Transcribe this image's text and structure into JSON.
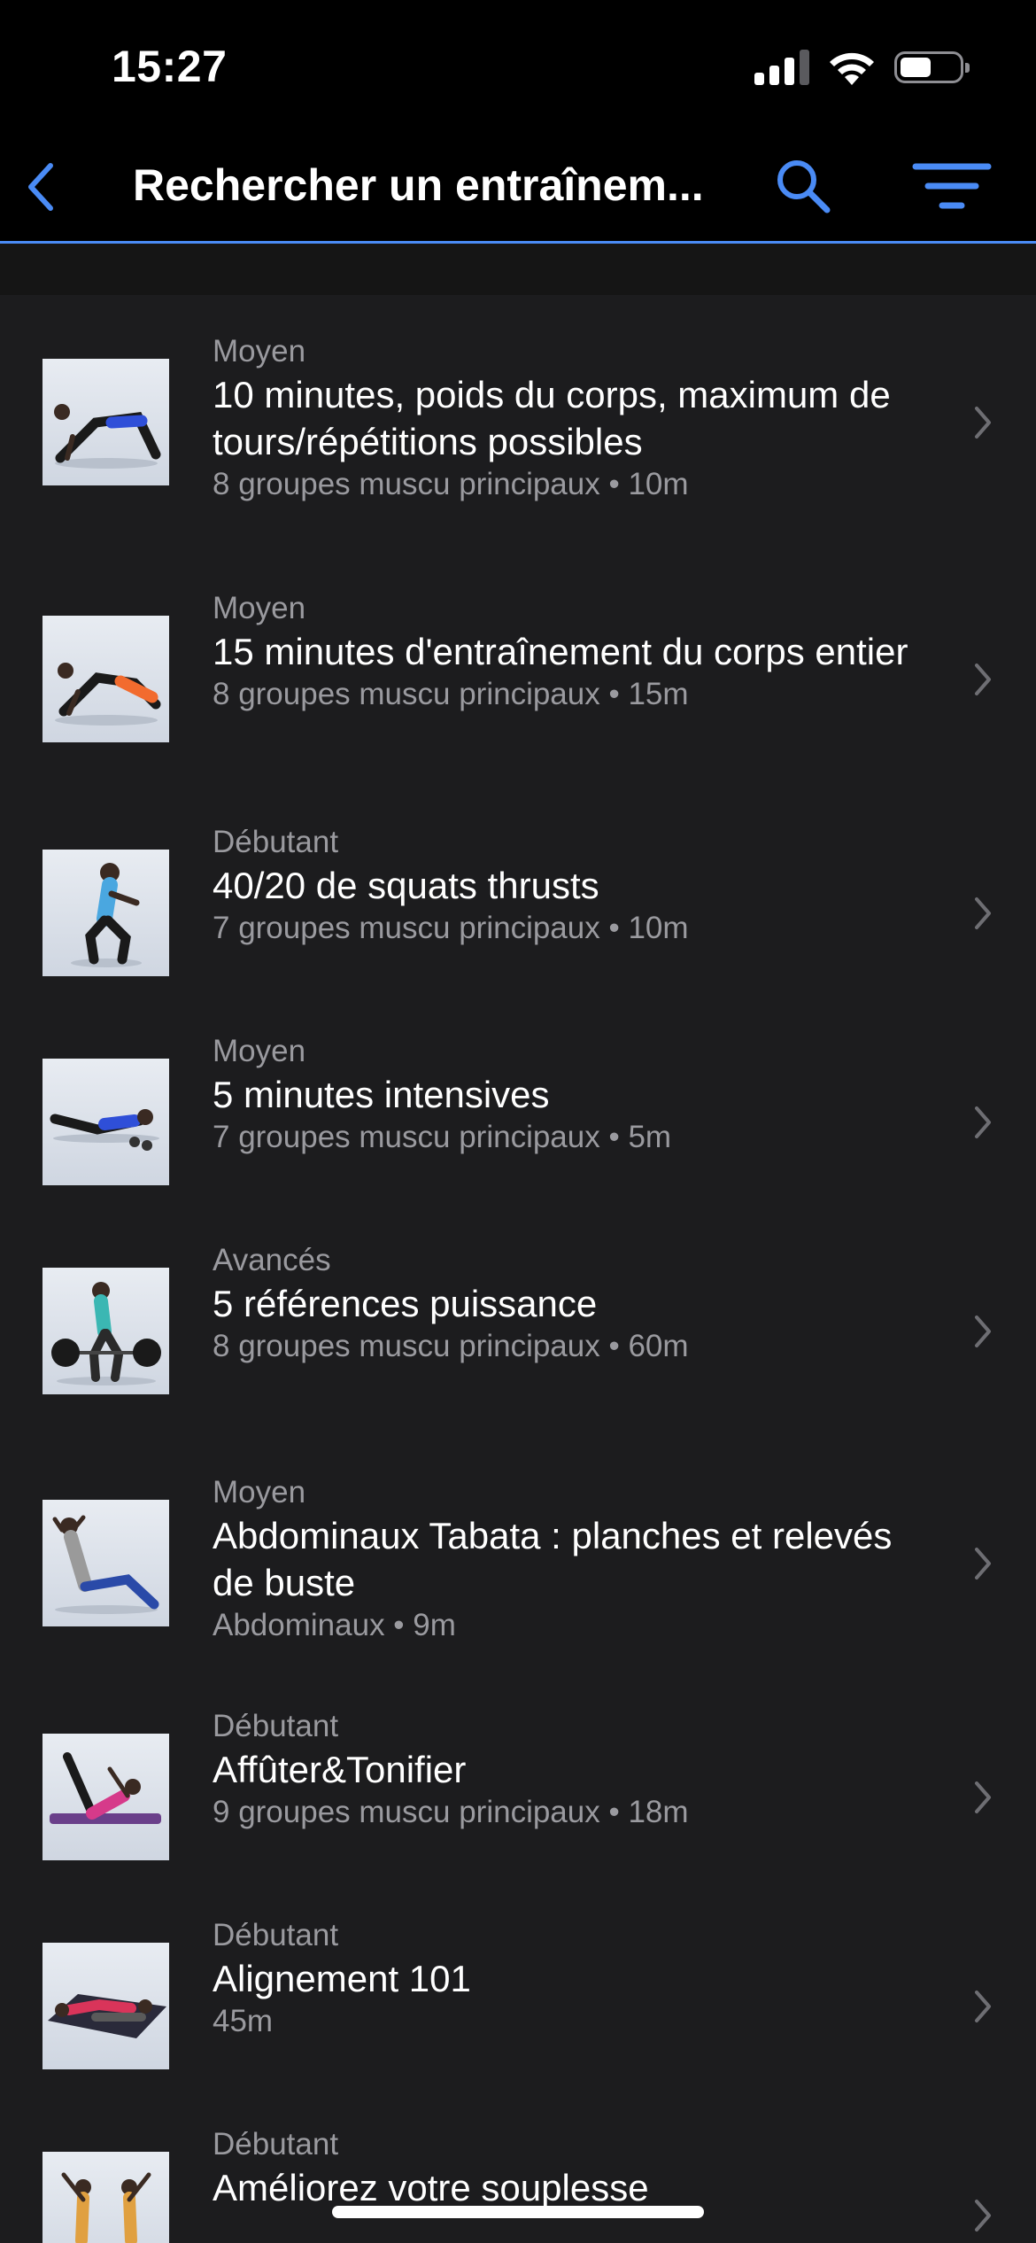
{
  "status_bar": {
    "time": "15:27"
  },
  "nav": {
    "title": "Rechercher un entraînem..."
  },
  "workouts": [
    {
      "level": "Moyen",
      "title": "10 minutes, poids du corps, maximum de tours/répétitions possibles",
      "details": "8 groupes muscu principaux • 10m"
    },
    {
      "level": "Moyen",
      "title": "15 minutes d'entraînement du corps entier",
      "details": "8 groupes muscu principaux • 15m"
    },
    {
      "level": "Débutant",
      "title": "40/20 de squats thrusts",
      "details": "7 groupes muscu principaux • 10m"
    },
    {
      "level": "Moyen",
      "title": "5 minutes intensives",
      "details": "7 groupes muscu principaux • 5m"
    },
    {
      "level": "Avancés",
      "title": "5 références puissance",
      "details": "8 groupes muscu principaux • 60m"
    },
    {
      "level": "Moyen",
      "title": "Abdominaux Tabata : planches et relevés de buste",
      "details": "Abdominaux • 9m"
    },
    {
      "level": "Débutant",
      "title": "Affûter&Tonifier",
      "details": "9 groupes muscu principaux • 18m"
    },
    {
      "level": "Débutant",
      "title": "Alignement 101",
      "details": "45m"
    },
    {
      "level": "Débutant",
      "title": "Améliorez votre souplesse",
      "details": ""
    }
  ],
  "colors": {
    "accent": "#4a8bf5",
    "list_bg": "#1c1c1e",
    "secondary_text": "#9a9a9f"
  }
}
